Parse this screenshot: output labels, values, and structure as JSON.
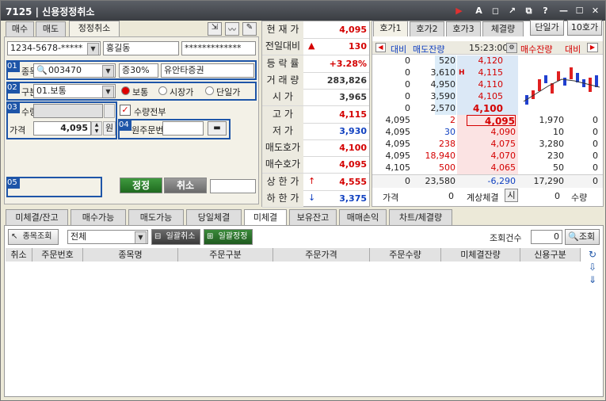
{
  "window": {
    "code": "7125",
    "title": "신용정정취소"
  },
  "order_tabs": [
    "매수",
    "매도",
    "정정취소"
  ],
  "account": {
    "number": "1234-5678-*****",
    "name": "홍길동",
    "password": "*************"
  },
  "stock": {
    "code": "003470",
    "margin": "증30%",
    "name": "유안타증권"
  },
  "division": {
    "value": "01.보통",
    "options": [
      "보통",
      "시장가",
      "단일가"
    ],
    "selected": "보통"
  },
  "qty": {
    "label": "수량",
    "all_label": "수량전부",
    "all_checked": true
  },
  "price": {
    "label": "가격",
    "value": "4,095",
    "unit": "원"
  },
  "orig_order": {
    "label": "원주문번호"
  },
  "labels": {
    "stock": "종목",
    "division": "구분"
  },
  "badges": [
    "01",
    "02",
    "03",
    "04",
    "05"
  ],
  "buttons": {
    "modify": "정정",
    "cancel": "취소"
  },
  "quote": [
    {
      "k": "현 재 가",
      "v": "4,095",
      "c": "red"
    },
    {
      "k": "전일대비",
      "v": "130",
      "c": "red",
      "arrow": "▲"
    },
    {
      "k": "등 락 률",
      "v": "+3.28%",
      "c": "red"
    },
    {
      "k": "거 래 량",
      "v": "283,826",
      "c": "dark"
    },
    {
      "k": "시  가",
      "v": "3,965",
      "c": "dark"
    },
    {
      "k": "고  가",
      "v": "4,115",
      "c": "red"
    },
    {
      "k": "저  가",
      "v": "3,930",
      "c": "blue"
    },
    {
      "k": "매도호가",
      "v": "4,100",
      "c": "red"
    },
    {
      "k": "매수호가",
      "v": "4,095",
      "c": "red"
    },
    {
      "k": "상 한 가",
      "v": "4,555",
      "c": "red",
      "arrow": "↑"
    },
    {
      "k": "하 한 가",
      "v": "3,375",
      "c": "blue",
      "arrow": "↓"
    }
  ],
  "hoga_tabs": [
    "호가1",
    "호가2",
    "호가3",
    "체결량",
    "단일가",
    "10호가"
  ],
  "hoga_header": {
    "diff": "대비",
    "ask": "매도잔량",
    "time": "15:23:00",
    "bid": "매수잔량",
    "bdiff": "대비"
  },
  "asks": [
    {
      "diff": "0",
      "qty": "520",
      "price": "4,120"
    },
    {
      "diff": "0",
      "qty": "3,610",
      "price": "4,115",
      "h": "H"
    },
    {
      "diff": "0",
      "qty": "4,950",
      "price": "4,110"
    },
    {
      "diff": "0",
      "qty": "3,590",
      "price": "4,105"
    },
    {
      "diff": "0",
      "qty": "2,570",
      "price": "4,100"
    }
  ],
  "bids": [
    {
      "trade": "4,095",
      "tq": "2",
      "price": "4,095",
      "qty": "1,970",
      "diff": "0"
    },
    {
      "trade": "4,095",
      "tq": "30",
      "price": "4,090",
      "qty": "10",
      "diff": "0"
    },
    {
      "trade": "4,095",
      "tq": "238",
      "price": "4,075",
      "qty": "3,280",
      "diff": "0"
    },
    {
      "trade": "4,095",
      "tq": "18,940",
      "price": "4,070",
      "qty": "230",
      "diff": "0"
    },
    {
      "trade": "4,105",
      "tq": "500",
      "price": "4,065",
      "qty": "50",
      "diff": "0"
    }
  ],
  "hoga_total": {
    "diff": "0",
    "ask": "23,580",
    "net": "-6,290",
    "bid": "17,290",
    "bdiff": "0"
  },
  "hoga_footer": {
    "price_label": "가격",
    "price": "0",
    "exp_label": "계상체결",
    "exp_time": "시",
    "qty": "0",
    "qty_label": "수량"
  },
  "bottom_tabs": [
    "미체결/잔고",
    "매수가능",
    "매도가능",
    "당일체결",
    "미체결",
    "보유잔고",
    "매매손익",
    "차트/체결량"
  ],
  "bottom_active": 4,
  "filter": {
    "lookup": "종목조회",
    "scope": "전체",
    "bulk_cancel": "일괄취소",
    "bulk_modify": "일괄정정",
    "count_label": "조회건수",
    "count": "0",
    "search": "조회"
  },
  "columns": [
    "취소",
    "주문번호",
    "종목명",
    "주문구분",
    "주문가격",
    "주문수량",
    "미체결잔량",
    "신용구분"
  ],
  "colors": {
    "accent": "#1e55a8",
    "up": "#d40000",
    "down": "#1040c0"
  }
}
